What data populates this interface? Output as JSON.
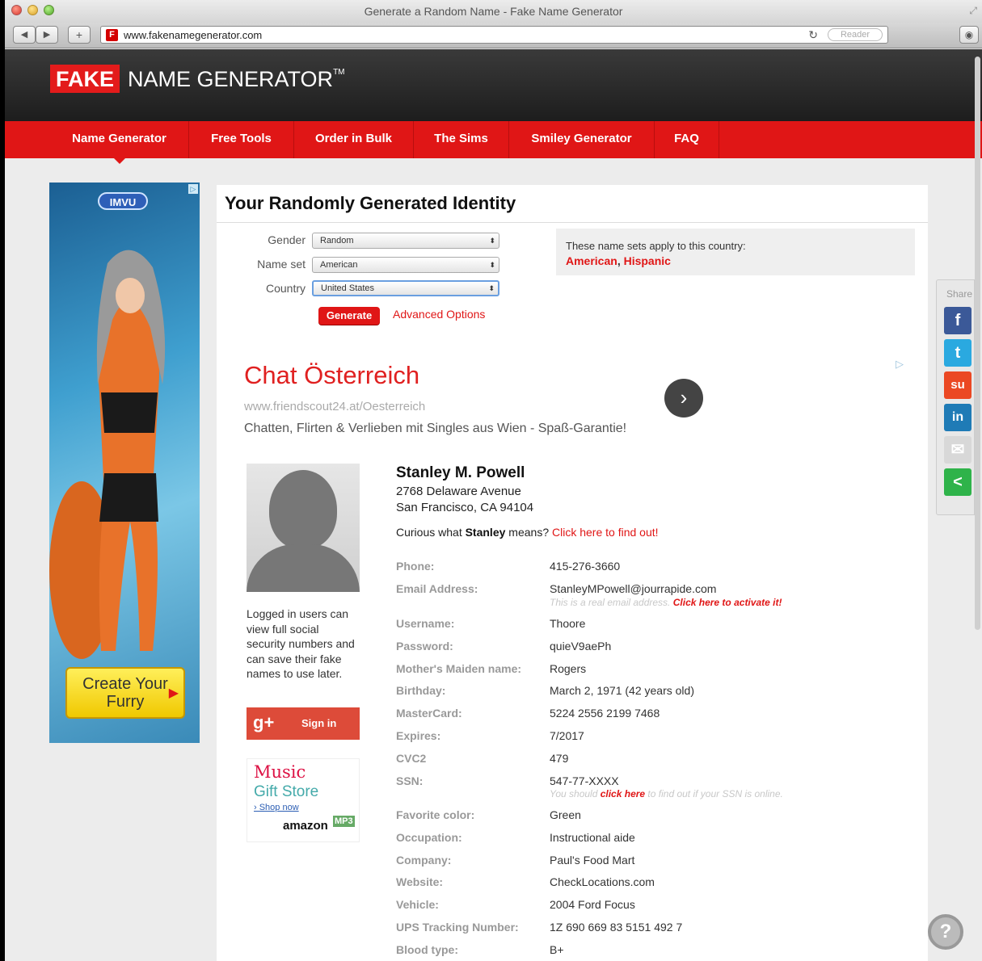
{
  "window": {
    "title": "Generate a Random Name - Fake Name Generator",
    "url": "www.fakenamegenerator.com",
    "reader_label": "Reader"
  },
  "site": {
    "logo_fake": "FAKE",
    "logo_rest": "NAME GENERATOR",
    "logo_tm": "TM",
    "nav": [
      {
        "label": "Name Generator",
        "active": true
      },
      {
        "label": "Free Tools"
      },
      {
        "label": "Order in Bulk"
      },
      {
        "label": "The Sims"
      },
      {
        "label": "Smiley Generator"
      },
      {
        "label": "FAQ"
      }
    ]
  },
  "left_ad": {
    "brand": "IMVU",
    "cta": "Create Your Furry"
  },
  "main": {
    "title": "Your Randomly Generated Identity",
    "form": {
      "gender_label": "Gender",
      "gender_value": "Random",
      "nameset_label": "Name set",
      "nameset_value": "American",
      "country_label": "Country",
      "country_value": "United States",
      "generate_label": "Generate",
      "advanced_label": "Advanced Options"
    },
    "country_box": {
      "intro": "These name sets apply to this country:",
      "set1": "American",
      "set2": "Hispanic"
    },
    "text_ad": {
      "headline": "Chat Österreich",
      "url": "www.friendscout24.at/Oesterreich",
      "description": "Chatten, Flirten & Verlieben mit Singles aus Wien - Spaß-Garantie!"
    },
    "logged_in_text": "Logged in users can view full social security numbers and can save their fake names to use later.",
    "google_signin": "Sign in",
    "amazon_ad": {
      "music": "Music",
      "gift": "Gift Store",
      "shop": "› Shop now",
      "logo": "amazon",
      "badge": "MP3"
    },
    "identity": {
      "name": "Stanley M. Powell",
      "address1": "2768 Delaware Avenue",
      "address2": "San Francisco, CA 94104",
      "curious_prefix": "Curious what ",
      "curious_name": "Stanley",
      "curious_mid": " means? ",
      "curious_link": "Click here to find out!",
      "fields": [
        {
          "label": "Phone:",
          "value": "415-276-3660"
        },
        {
          "label": "Email Address:",
          "value": "StanleyMPowell@jourrapide.com",
          "note": "This is a real email address. ",
          "note_link": "Click here to activate it!"
        },
        {
          "label": "Username:",
          "value": "Thoore"
        },
        {
          "label": "Password:",
          "value": "quieV9aePh"
        },
        {
          "label": "Mother's Maiden name:",
          "value": "Rogers"
        },
        {
          "label": "Birthday:",
          "value": "March 2, 1971 (42 years old)"
        },
        {
          "label": "MasterCard:",
          "value": "5224 2556 2199 7468"
        },
        {
          "label": "Expires:",
          "value": "7/2017"
        },
        {
          "label": "CVC2",
          "value": "479"
        },
        {
          "label": "SSN:",
          "value": "547-77-XXXX",
          "note": "You should ",
          "note_link": "click here",
          "note_tail": " to find out if your SSN is online."
        },
        {
          "label": "Favorite color:",
          "value": "Green"
        },
        {
          "label": "Occupation:",
          "value": "Instructional aide"
        },
        {
          "label": "Company:",
          "value": "Paul's Food Mart"
        },
        {
          "label": "Website:",
          "value": "CheckLocations.com"
        },
        {
          "label": "Vehicle:",
          "value": "2004 Ford Focus"
        },
        {
          "label": "UPS Tracking Number:",
          "value": "1Z 690 669 83 5151 492 7"
        },
        {
          "label": "Blood type:",
          "value": "B+"
        }
      ]
    }
  },
  "share": {
    "label": "Share",
    "buttons": [
      {
        "icon": "facebook-icon",
        "glyph": "f",
        "color": "#3b5998"
      },
      {
        "icon": "twitter-icon",
        "glyph": "t",
        "color": "#2aa9e0"
      },
      {
        "icon": "stumbleupon-icon",
        "glyph": "su",
        "color": "#eb4823"
      },
      {
        "icon": "linkedin-icon",
        "glyph": "in",
        "color": "#1f7bb6"
      },
      {
        "icon": "email-icon",
        "glyph": "✉",
        "color": "#d8d8d8"
      },
      {
        "icon": "sharethis-icon",
        "glyph": "<",
        "color": "#2fb34a"
      }
    ]
  },
  "colors": {
    "brand_red": "#e01616",
    "header_dark": "#1d1d1d"
  }
}
